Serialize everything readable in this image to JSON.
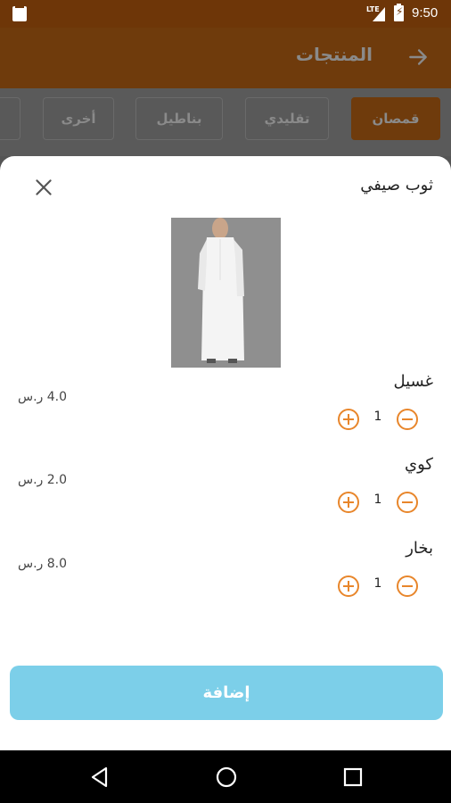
{
  "status_bar": {
    "time": "9:50",
    "network": "LTE"
  },
  "app_bar": {
    "title": "المنتجات",
    "back_icon": "arrow-right-icon"
  },
  "categories": [
    {
      "label": "قمصان",
      "active": true
    },
    {
      "label": "تقليدي",
      "active": false
    },
    {
      "label": "بناطيل",
      "active": false
    },
    {
      "label": "أخرى",
      "active": false
    }
  ],
  "sheet": {
    "product_title": "ثوب صيفي",
    "close_icon": "close-icon",
    "product_image": "white-thobe-image",
    "services": [
      {
        "name": "غسيل",
        "price": "4.0 ر.س",
        "qty": "1"
      },
      {
        "name": "كوي",
        "price": "2.0 ر.س",
        "qty": "1"
      },
      {
        "name": "بخار",
        "price": "8.0 ر.س",
        "qty": "1"
      }
    ],
    "add_label": "إضافة"
  },
  "colors": {
    "accent": "#e8862b",
    "primary": "#8b4a10",
    "button": "#7ccfe9"
  }
}
